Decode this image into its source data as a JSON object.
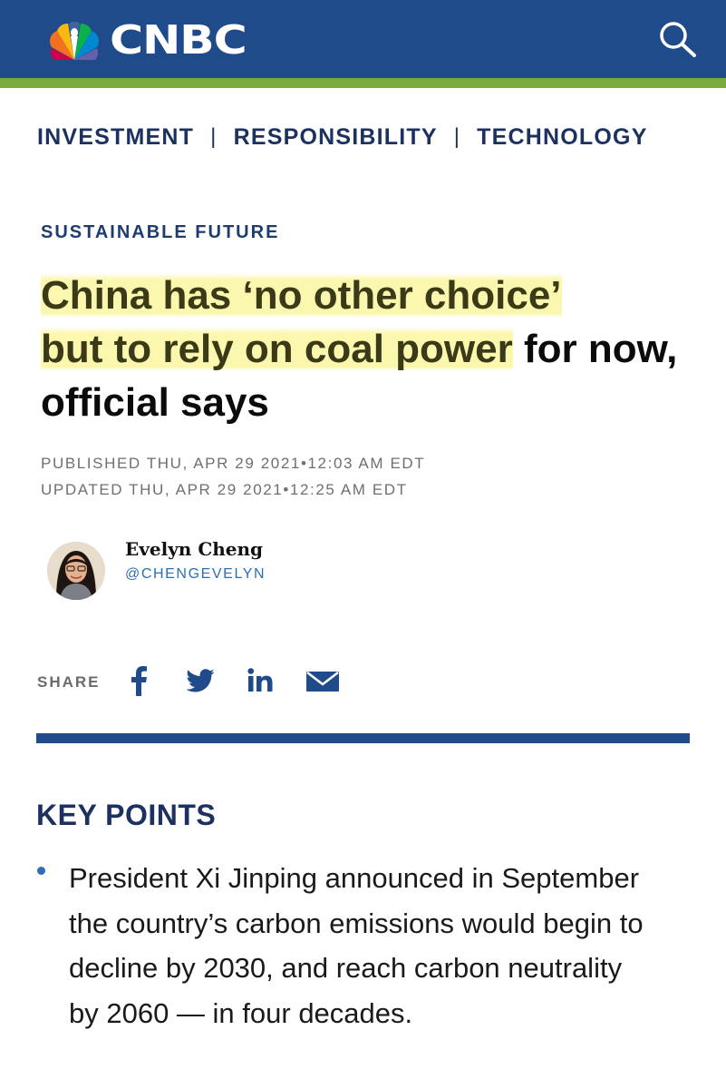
{
  "header": {
    "brand": "CNBC",
    "icons": {
      "logo": "nbc-peacock-icon",
      "search": "search-icon"
    },
    "colors": {
      "bar": "#1f4b8a",
      "accent_strip": "#7aab3b"
    }
  },
  "subnav": {
    "items": [
      "INVESTMENT",
      "RESPONSIBILITY",
      "TECHNOLOGY"
    ],
    "separator": "|"
  },
  "article": {
    "kicker": "SUSTAINABLE FUTURE",
    "headline_highlighted_1": "China has ‘no other choice’",
    "headline_highlighted_2": "but to rely on coal power",
    "headline_rest": " for now, official says",
    "published": "PUBLISHED THU, APR 29 2021•12:03 AM EDT",
    "updated": "UPDATED THU, APR 29 2021•12:25 AM EDT",
    "author": {
      "name": "Evelyn Cheng",
      "handle": "@CHENGEVELYN"
    },
    "share": {
      "label": "SHARE",
      "icons": [
        "facebook-icon",
        "twitter-icon",
        "linkedin-icon",
        "email-icon"
      ]
    },
    "key_points": {
      "title": "KEY POINTS",
      "items": [
        "President Xi Jinping announced in September the country’s carbon emissions would begin to decline by 2030, and reach carbon neutrality by 2060 — in four decades."
      ]
    }
  }
}
